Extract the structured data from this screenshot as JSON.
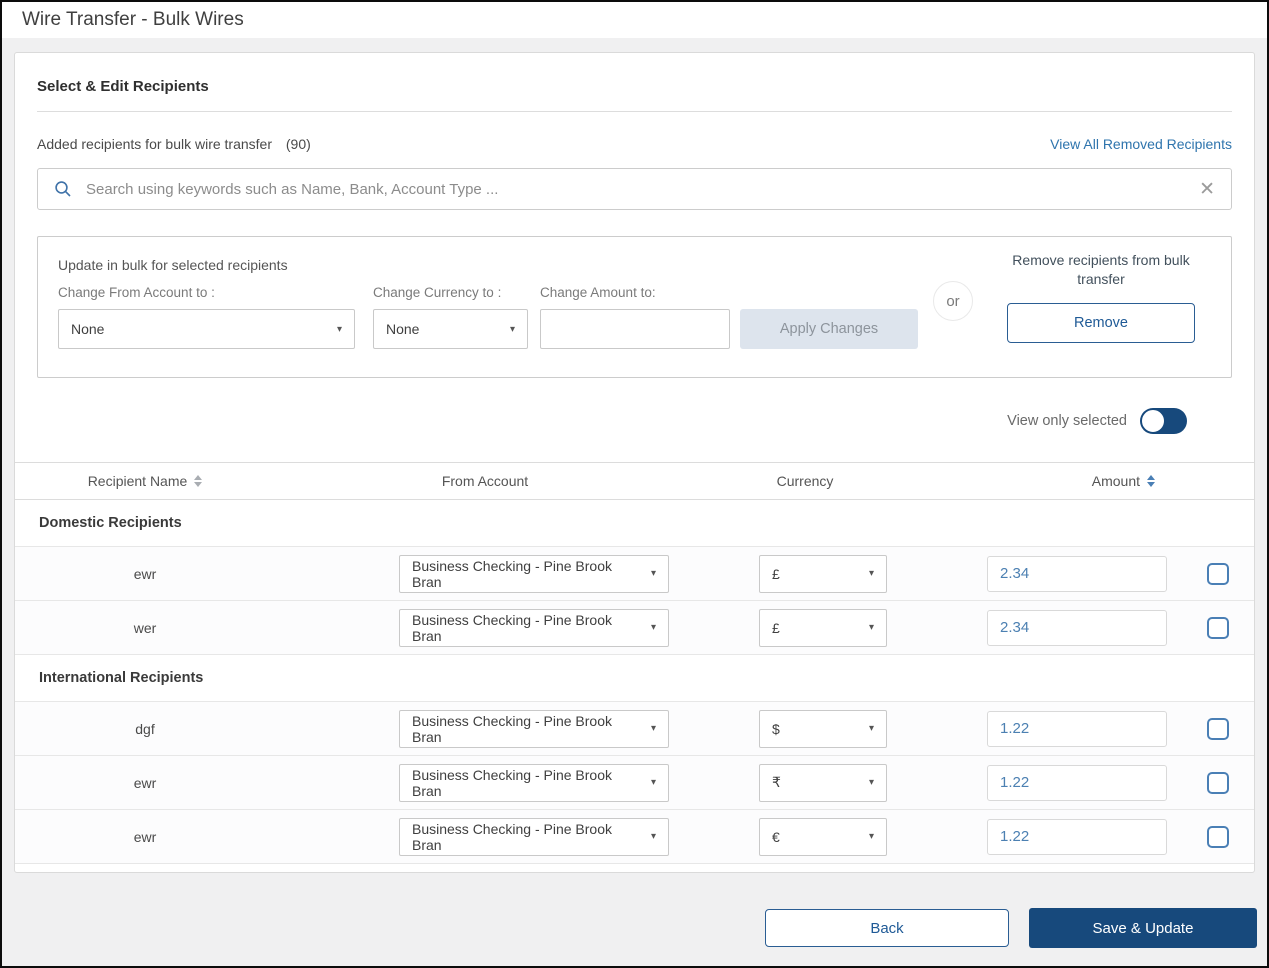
{
  "page": {
    "title": "Wire Transfer - Bulk Wires"
  },
  "panel": {
    "title": "Select & Edit Recipients",
    "added_label": "Added recipients for bulk wire transfer",
    "added_count": "(90)",
    "view_removed_link": "View All Removed Recipients"
  },
  "search": {
    "placeholder": "Search using keywords such as Name, Bank, Account Type ...",
    "value": ""
  },
  "icons": {
    "clear": "✕",
    "dropdown_arrow": "▾"
  },
  "bulk_update": {
    "title": "Update in bulk for selected recipients",
    "from_account_label": "Change From Account to :",
    "from_account_value": "None",
    "currency_label": "Change Currency to :",
    "currency_value": "None",
    "amount_label": "Change Amount to:",
    "amount_value": "",
    "apply_label": "Apply Changes",
    "or_label": "or",
    "remove_caption": "Remove recipients from bulk transfer",
    "remove_label": "Remove"
  },
  "toggle": {
    "label": "View only selected",
    "state": "off"
  },
  "table": {
    "headers": {
      "recipient_name": "Recipient Name",
      "from_account": "From Account",
      "currency": "Currency",
      "amount": "Amount"
    },
    "sections": [
      {
        "label": "Domestic Recipients",
        "rows": [
          {
            "name": "ewr",
            "from_account": "Business Checking - Pine Brook Bran",
            "currency": "£",
            "amount": "2.34",
            "checked": false
          },
          {
            "name": "wer",
            "from_account": "Business Checking - Pine Brook Bran",
            "currency": "£",
            "amount": "2.34",
            "checked": false
          }
        ]
      },
      {
        "label": "International Recipients",
        "rows": [
          {
            "name": "dgf",
            "from_account": "Business Checking - Pine Brook Bran",
            "currency": "$",
            "amount": "1.22",
            "checked": false
          },
          {
            "name": "ewr",
            "from_account": "Business Checking - Pine Brook Bran",
            "currency": "₹",
            "amount": "1.22",
            "checked": false
          },
          {
            "name": "ewr",
            "from_account": "Business Checking - Pine Brook Bran",
            "currency": "€",
            "amount": "1.22",
            "checked": false
          }
        ]
      }
    ]
  },
  "footer": {
    "back_label": "Back",
    "save_label": "Save & Update"
  },
  "colors": {
    "navy": "#17497c",
    "link_blue": "#2e74ad",
    "value_blue": "#4c80b2",
    "checkbox_blue": "#4a7fb5",
    "disabled_button_bg": "#dde4ed",
    "background_gray": "#f0f0f1"
  }
}
